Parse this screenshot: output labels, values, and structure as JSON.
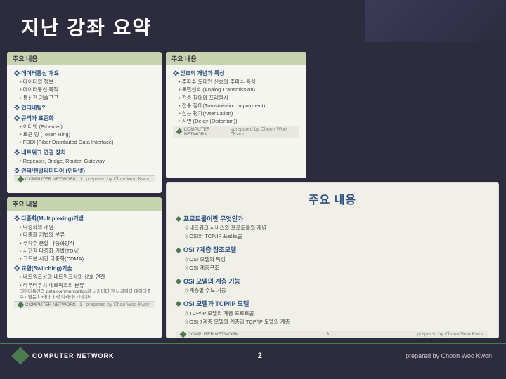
{
  "page": {
    "title": "지난 강좌 요약",
    "background_color": "#2c2c3e"
  },
  "slides": {
    "left_top_card": {
      "header": "주요 내용",
      "sections": [
        {
          "heading": "데이터통신 개요",
          "items": [
            "데이터의 정보",
            "데이터통신 목적",
            "통신간 기술구구"
          ]
        },
        {
          "heading": "인터네팅?",
          "items": []
        },
        {
          "heading": "규격과 표준화",
          "items": [
            "이더넷 (Ethernet)",
            "토큰 링 (Token Ring)",
            "FDDI (Fiber Distributed Data Interface)"
          ]
        },
        {
          "heading": "네트워크 연결 장치",
          "items": [
            "Repeater, Bridge, Router, Gateway"
          ]
        },
        {
          "heading": "인터넷/멀티미디어 (인터넷)",
          "items": []
        }
      ],
      "slide_number": "1",
      "prepared_by": "prepared by Chan Woo Kwon"
    },
    "left_bottom_card": {
      "header": "주요 내용",
      "sections": [
        {
          "heading": "다중화(Multiplexing)기법",
          "items": [
            "다중화의 개념",
            "다중화 기법의 분류",
            "주파수 분할 다중화방식",
            "시간적 다중화 기법(TDM)",
            "코드분 시간 다중화(CDMA)"
          ]
        },
        {
          "heading": "교환(Switching)기술",
          "items": [
            "네트워크상의 네트워크상의 상호 연결",
            "라우터우치 네트워크의 분류",
            "데이터통신의 data communication과 나라마다 각 나라마다 데이터를 주고받는 내용 나라마다 각 나라마다 데이터를 주고"
          ]
        }
      ],
      "slide_number": "3",
      "prepared_by": "prepared by Chan Woo Kwon"
    },
    "right_top_card": {
      "header": "주요 내용",
      "sections": [
        {
          "heading": "신호의 개념과 특성",
          "items": [
            "주파수 도메인 신호의 주파수 특성",
            "복합신호 (Analog Transmission)",
            "전송 장애와 프리퀀시",
            "전송 장애(Transmission Impairment)",
            "성능 평가(Attenuation)",
            "지연 (Delay (Distortion))"
          ]
        }
      ],
      "slide_number": "3",
      "prepared_by": "prepared by Choon Woo Kwon"
    },
    "main_center_card": {
      "title": "주요 내용",
      "sections": [
        {
          "heading": "프로토콜이란 무엇인가",
          "items": [
            "네트워크 서비스와 프로토콜의 개념",
            "OSI와 TCP/IP 프로토콜"
          ]
        },
        {
          "heading": "OSI 7계층 참조모델",
          "items": [
            "OSI 모델의 특성",
            "OSI 계층구조"
          ]
        },
        {
          "heading": "OSI 모델의 계층 기능",
          "items": [
            "계층별 주요 기능"
          ]
        },
        {
          "heading": "OSI 모델과 TCP/IP 모델",
          "items": [
            "TCP/IP 모델의 계층 프로토콜",
            "OSI 7계층 모델의 계층과 TCP/IP 모델의 계층"
          ]
        }
      ],
      "slide_number": "3",
      "prepared_by": "prepared by Choon Woo Kwon"
    }
  },
  "footer": {
    "logo_text": "COMPUTER NETWORK",
    "page_number": "2",
    "credit": "prepared by Choon Woo Kwon"
  }
}
